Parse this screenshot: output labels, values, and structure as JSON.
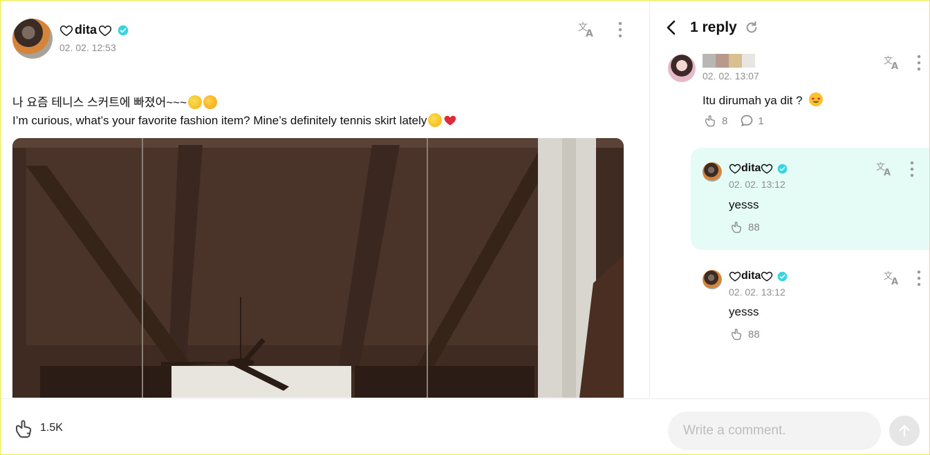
{
  "post": {
    "author": "dita",
    "time": "02. 02. 12:53",
    "text_ko": "나 요즘 테니스 스커트에 빠졌어~~~",
    "text_en": "I’m curious, what’s your favorite fashion item? Mine’s definitely tennis skirt lately",
    "like_count": "1.5K"
  },
  "thread": {
    "title": "1 reply"
  },
  "comments": [
    {
      "time": "02. 02. 13:07",
      "text": "Itu dirumah ya dit ?",
      "likes": "8",
      "replies": "1"
    },
    {
      "author": "dita",
      "time": "02. 02. 13:12",
      "text": "yesss",
      "likes": "88",
      "highlighted": true
    },
    {
      "author": "dita",
      "time": "02. 02. 13:12",
      "text": "yesss",
      "likes": "88"
    }
  ],
  "composer": {
    "placeholder": "Write a comment."
  },
  "colors": {
    "verified": "#3ad3e0",
    "highlight": "#e5fbf5",
    "muted": "#8d8d8d",
    "border": "#ececec"
  },
  "icons": {
    "translate": "translate-icon",
    "more": "more-vertical-icon",
    "like": "like-hand-icon",
    "reply": "comment-bubble-icon",
    "back": "chevron-left-icon",
    "refresh": "refresh-icon",
    "send": "arrow-up-icon"
  }
}
